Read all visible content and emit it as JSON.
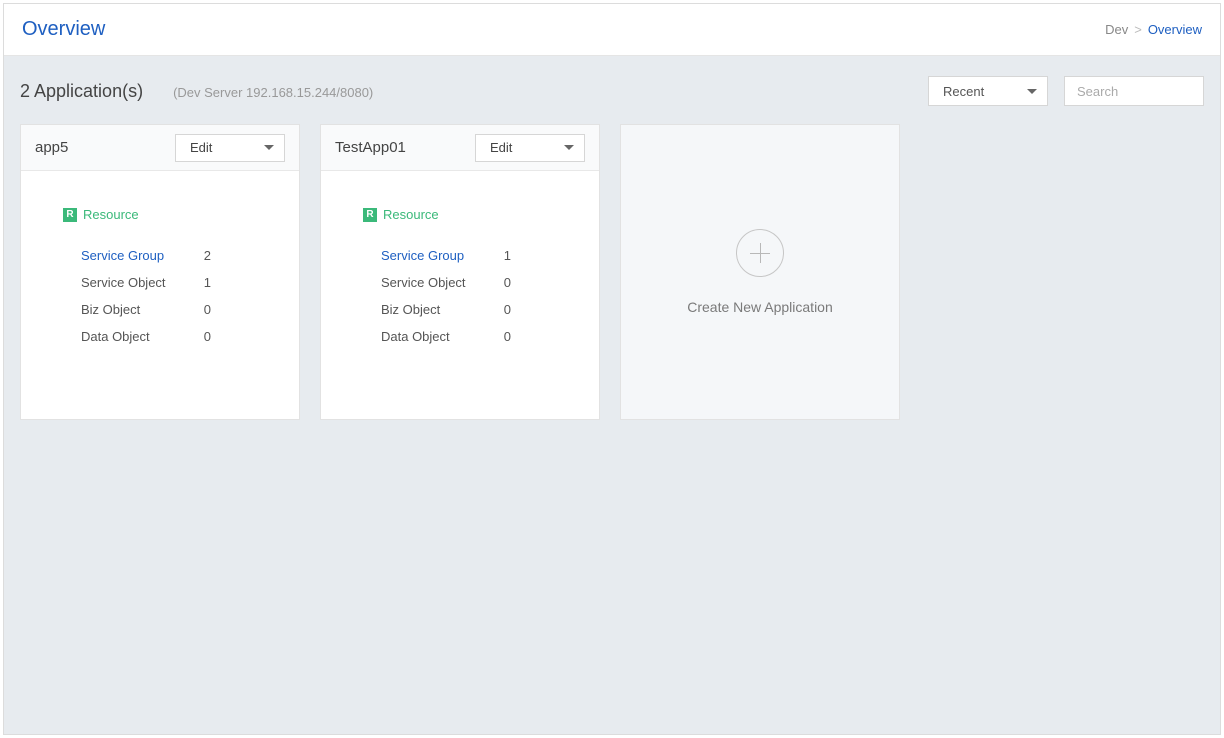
{
  "header": {
    "title": "Overview",
    "breadcrumb": {
      "env": "Dev",
      "sep": ">",
      "page": "Overview"
    }
  },
  "sub": {
    "count_label": "2 Application(s)",
    "server_label": "(Dev Server 192.168.15.244/8080)",
    "sort_selected": "Recent",
    "search_placeholder": "Search"
  },
  "resource_section": {
    "badge": "R",
    "label": "Resource"
  },
  "apps": [
    {
      "name": "app5",
      "edit_label": "Edit",
      "stats": [
        {
          "label": "Service Group",
          "value": "2",
          "link": true
        },
        {
          "label": "Service Object",
          "value": "1",
          "link": false
        },
        {
          "label": "Biz Object",
          "value": "0",
          "link": false
        },
        {
          "label": "Data Object",
          "value": "0",
          "link": false
        }
      ]
    },
    {
      "name": "TestApp01",
      "edit_label": "Edit",
      "stats": [
        {
          "label": "Service Group",
          "value": "1",
          "link": true
        },
        {
          "label": "Service Object",
          "value": "0",
          "link": false
        },
        {
          "label": "Biz Object",
          "value": "0",
          "link": false
        },
        {
          "label": "Data Object",
          "value": "0",
          "link": false
        }
      ]
    }
  ],
  "create_card": {
    "label": "Create New Application"
  }
}
